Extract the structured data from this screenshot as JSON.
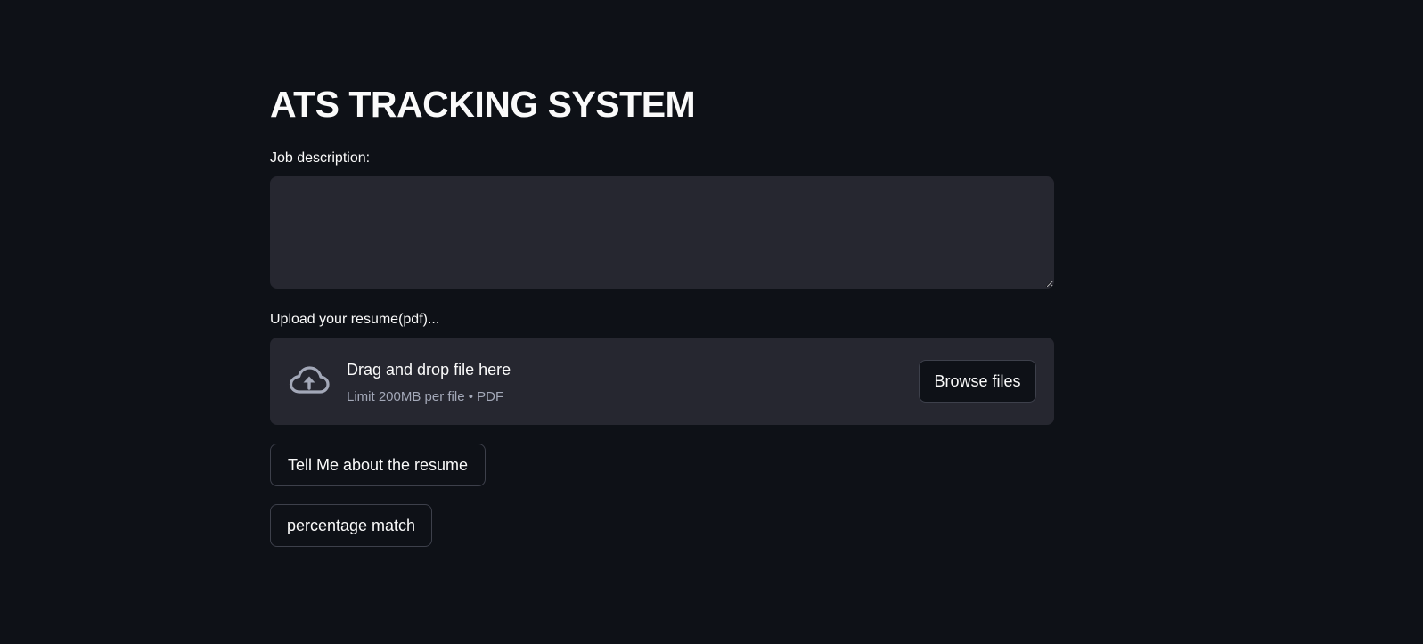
{
  "page": {
    "title": "ATS TRACKING SYSTEM"
  },
  "job_description": {
    "label": "Job description:",
    "value": "",
    "placeholder": ""
  },
  "uploader": {
    "label": "Upload your resume(pdf)...",
    "dropzone_title": "Drag and drop file here",
    "dropzone_hint": "Limit 200MB per file • PDF",
    "browse_label": "Browse files",
    "icon": "cloud-upload-icon"
  },
  "actions": {
    "tell_me_label": "Tell Me about the resume",
    "percentage_label": "percentage match"
  },
  "colors": {
    "background": "#0e1117",
    "surface": "#262730",
    "text": "#fafafa",
    "muted_text": "#a3a8b8",
    "border": "#3d404b"
  }
}
